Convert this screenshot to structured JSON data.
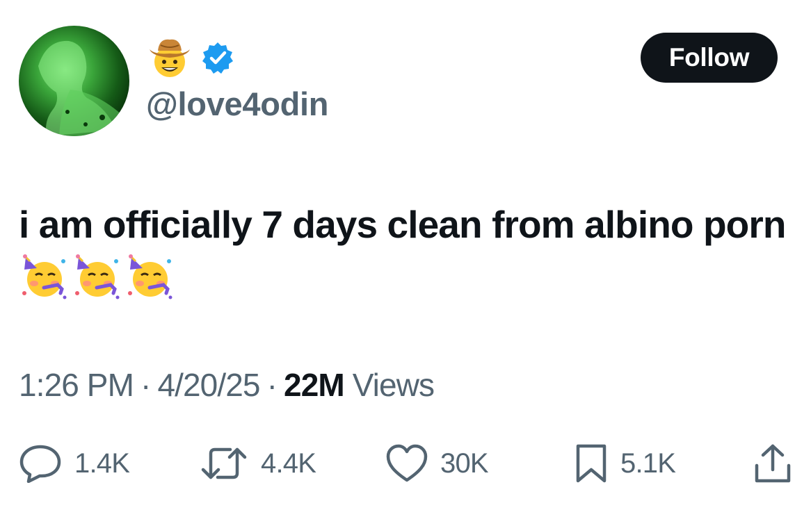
{
  "author": {
    "handle": "@love4odin",
    "name_emoji": "cowboy-hat-face",
    "verified": true,
    "verified_color": "#1d9bf0"
  },
  "follow_button": {
    "label": "Follow"
  },
  "tweet": {
    "text": "i am officially 7 days clean from albino porn",
    "emojis": [
      "partying-face",
      "partying-face",
      "partying-face"
    ]
  },
  "meta": {
    "time": "1:26 PM",
    "separator": "·",
    "date": "4/20/25",
    "views_count": "22M",
    "views_label": "Views"
  },
  "actions": {
    "replies": "1.4K",
    "reposts": "4.4K",
    "likes": "30K",
    "bookmarks": "5.1K"
  },
  "colors": {
    "text_primary": "#0f1419",
    "text_secondary": "#536471",
    "button_bg": "#0f1419",
    "verified": "#1d9bf0"
  }
}
